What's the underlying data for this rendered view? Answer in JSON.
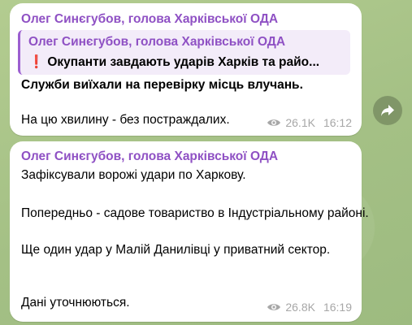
{
  "colors": {
    "author": "#8f51c4",
    "reply_bar": "#9c5fd0",
    "reply_bg": "#f3ecf9",
    "meta": "#a7a7a7",
    "alert_mark": "#e0242e"
  },
  "messages": [
    {
      "author": "Олег Синєгубов, голова Харківської ОДА",
      "reply": {
        "author": "Олег Синєгубов, голова Харківської ОДА",
        "mark": "❗",
        "text": "Окупанти завдають ударів  Харків та райо..."
      },
      "lines": [
        "Служби виїхали на перевірку місць влучань.",
        "На цю хвилину - без постраждалих."
      ],
      "views": "26.1K",
      "time": "16:12"
    },
    {
      "author": "Олег Синєгубов, голова Харківської ОДА",
      "lines": [
        "Зафіксували ворожі удари по Харкову.",
        "Попередньо - садове товариство в Індустріальному районі.",
        "Ще один удар у Малій Данилівці у приватний сектор.",
        "Дані уточнюються."
      ],
      "views": "26.8K",
      "time": "16:19"
    }
  ],
  "share_icon": "share-arrow-icon",
  "view_icon": "eye-icon"
}
